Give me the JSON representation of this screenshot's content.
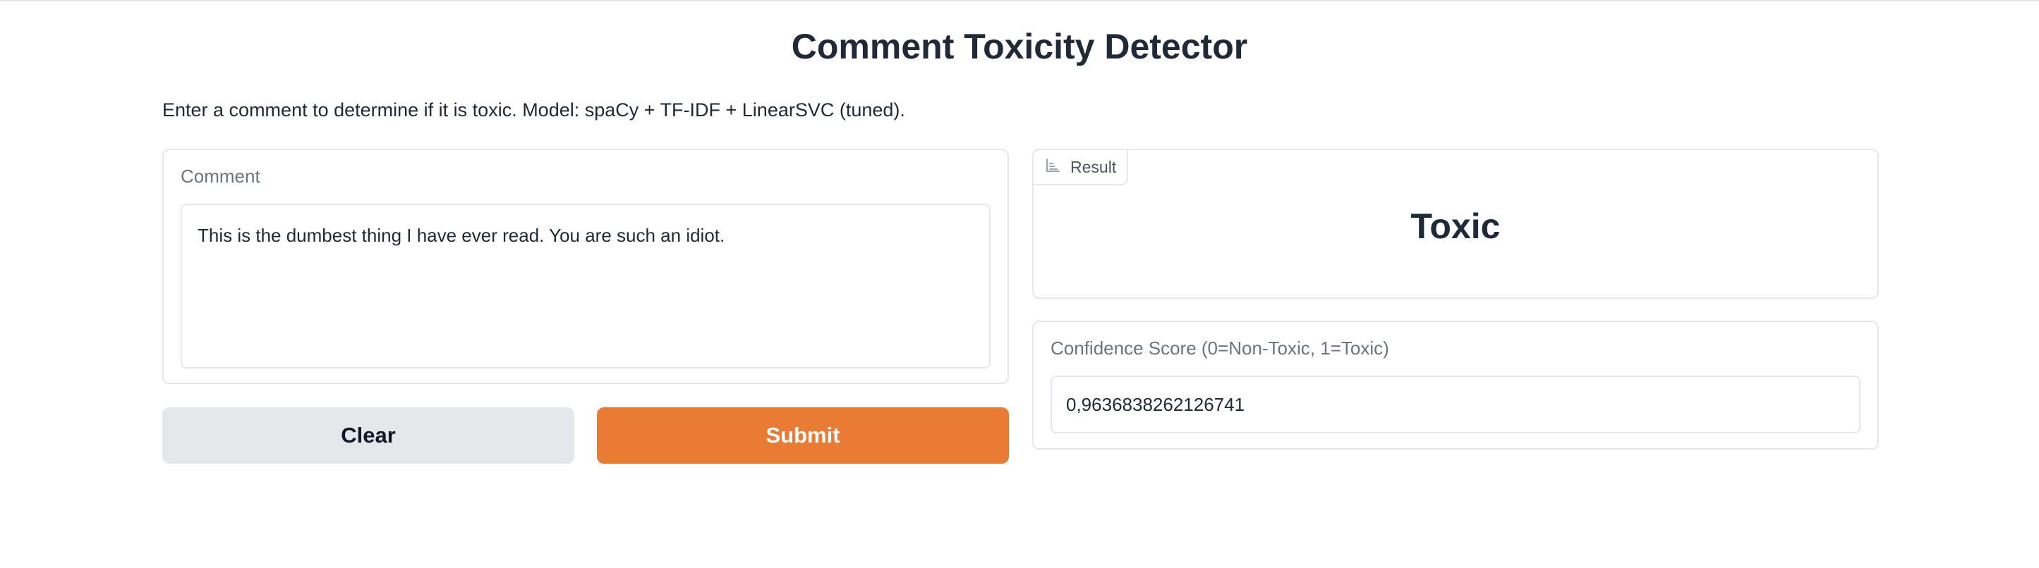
{
  "page": {
    "title": "Comment Toxicity Detector",
    "description": "Enter a comment to determine if it is toxic. Model: spaCy + TF-IDF + LinearSVC (tuned)."
  },
  "input": {
    "label": "Comment",
    "value": "This is the dumbest thing I have ever read. You are such an idiot."
  },
  "buttons": {
    "clear_label": "Clear",
    "submit_label": "Submit"
  },
  "result": {
    "tab_label": "Result",
    "tab_icon": "bar-chart-icon",
    "value": "Toxic"
  },
  "confidence": {
    "label": "Confidence Score (0=Non-Toxic, 1=Toxic)",
    "value": "0,9636838262126741"
  },
  "colors": {
    "accent": "#e97b35",
    "secondary_button": "#e5e7eb",
    "border": "#e5e7eb",
    "label_text": "#6b7280"
  }
}
